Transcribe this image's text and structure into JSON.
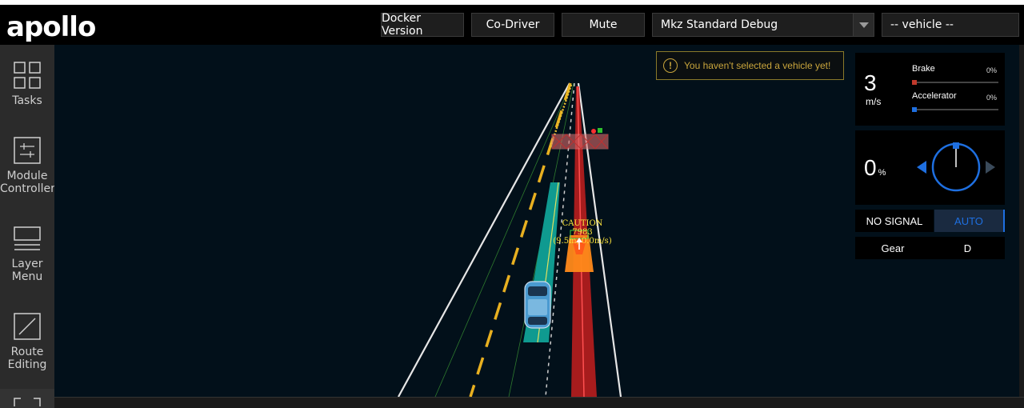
{
  "app": {
    "logo_text": "apollo"
  },
  "header": {
    "docker_label": "Docker Version",
    "codriver_label": "Co-Driver",
    "mute_label": "Mute",
    "mode_select": "Mkz Standard Debug",
    "vehicle_select": "-- vehicle --"
  },
  "sidebar": {
    "items": [
      {
        "label": "Tasks",
        "icon": "tasks-icon"
      },
      {
        "label": "Module Controller",
        "icon": "module-controller-icon"
      },
      {
        "label": "Layer Menu",
        "icon": "layer-menu-icon"
      },
      {
        "label": "Route Editing",
        "icon": "route-editing-icon"
      }
    ]
  },
  "notification": {
    "text": "You haven't selected a vehicle yet!",
    "icon": "warning-icon"
  },
  "dashboard": {
    "speed_value": "3",
    "speed_unit": "m/s",
    "brake_label": "Brake",
    "brake_pct": "0%",
    "brake_fraction": 0,
    "accelerator_label": "Accelerator",
    "accelerator_pct": "0%",
    "accelerator_fraction": 0,
    "steering_value": "0",
    "steering_unit": "%",
    "signal": "NO SIGNAL",
    "drive_mode": "AUTO",
    "gear_label": "Gear",
    "gear_value": "D"
  },
  "obstacle": {
    "status": "CAUTION",
    "id": "7983",
    "info": "(9.5m, 0.0m/s)"
  },
  "colors": {
    "brake": "#c0392b",
    "accelerator": "#1e6fe0",
    "auto": "#1e6fe0",
    "warning": "#c9a53c",
    "lane_yellow": "#e8b020",
    "path_teal": "#0f9a90",
    "decision_red": "#d42525"
  }
}
